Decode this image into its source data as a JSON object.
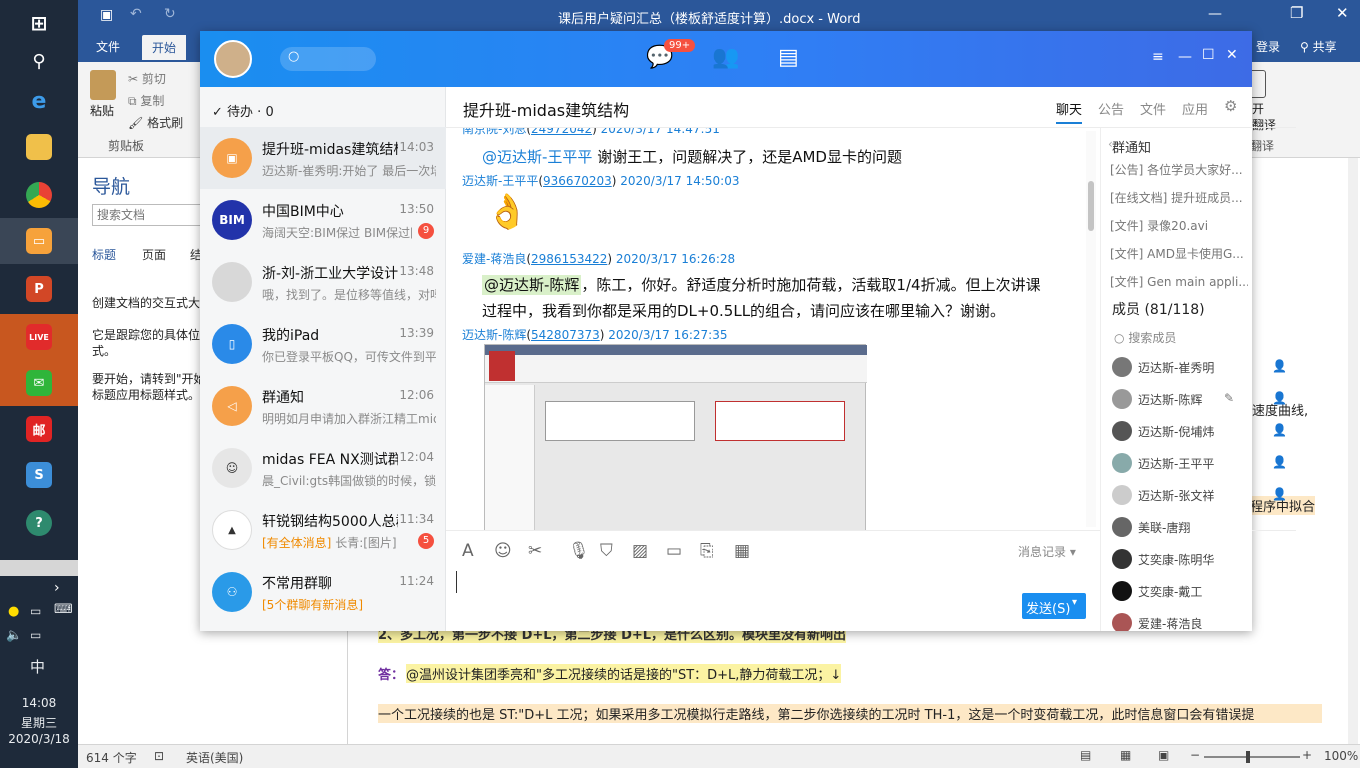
{
  "taskbar": {
    "items": [
      {
        "label": "start-icon"
      },
      {
        "label": "search-icon"
      },
      {
        "label": "edge-icon"
      },
      {
        "label": "explorer-icon"
      },
      {
        "label": "chrome-icon"
      },
      {
        "label": "app-icon"
      },
      {
        "label": "powerpoint-icon"
      },
      {
        "label": "live-icon"
      },
      {
        "label": "wechat-icon"
      },
      {
        "label": "mail-icon"
      },
      {
        "label": "s-icon"
      },
      {
        "label": "help-icon"
      }
    ],
    "ime": "中",
    "time": "14:08",
    "weekday": "星期三",
    "date": "2020/3/18"
  },
  "word": {
    "title": "课后用户疑问汇总（楼板舒适度计算）.docx - Word",
    "tabs": {
      "file": "文件",
      "home": "开始"
    },
    "login": "登录",
    "share": "共享",
    "clipboard": {
      "paste": "粘贴",
      "cut": "剪切",
      "copy": "复制",
      "format_painter": "格式刷",
      "group": "剪贴板"
    },
    "translate": {
      "open": "打开",
      "line2": "道翻译",
      "group": "道翻译"
    },
    "nav": {
      "title": "导航",
      "search_placeholder": "搜索文档",
      "tabs": [
        "标题",
        "页面",
        "结"
      ],
      "p1": "创建文档的交互式大",
      "p2a": "它是跟踪您的具体位",
      "p2b": "式。",
      "p3a": "要开始，请转到\"开始",
      "p3b": "标题应用标题样式。"
    },
    "doc": {
      "right1": "速度曲线,",
      "right2": "程序中拟合",
      "line_q2": "2、多工况，第一步不接 D+L，第二步接 D+L，是什么区别。模块里没有新响出",
      "answer_label": "答：",
      "answer_text": "@温州设计集团季亮和\"多工况接续的话是接的\"ST：D+L,静力荷载工况；↓",
      "line3": "一个工况接续的也是 ST:\"D+L 工况；如果采用多工况模拟行走路线，第二步你选接续的工况时 TH-1，这是一个时变荷载工况，此时信息窗口会有错误提"
    },
    "status": {
      "words": "614 个字",
      "lang": "英语(美国)",
      "zoom": "100%"
    }
  },
  "qq": {
    "badge": "99+",
    "todo": "待办 · 0",
    "conversations": [
      {
        "name": "提升班-midas建筑结构",
        "time": "14:03",
        "preview": "迈达斯-崔秀明:开始了 最后一次培训",
        "badge": ""
      },
      {
        "name": "中国BIM中心",
        "time": "13:50",
        "preview": "海阔天空:BIM保过 BIM保过[图片]",
        "badge": "9"
      },
      {
        "name": "浙-刘-浙工业大学设计院",
        "time": "13:48",
        "preview": "哦，找到了。是位移等值线，对吗",
        "badge": ""
      },
      {
        "name": "我的iPad",
        "time": "13:39",
        "preview": "你已登录平板QQ，可传文件到平板",
        "badge": ""
      },
      {
        "name": "群通知",
        "time": "12:06",
        "preview": "明明如月申请加入群浙江精工midas",
        "badge": ""
      },
      {
        "name": "midas FEA NX测试群",
        "time": "12:04",
        "preview": "晨_Civil:gts韩国做锁的时候，锁",
        "badge": ""
      },
      {
        "name": "轩锐钢结构5000人总群",
        "time": "11:34",
        "preview_tag": "[有全体消息]",
        "preview": "长青:[图片]",
        "badge": "5"
      },
      {
        "name": "不常用群聊",
        "time": "11:24",
        "preview_tag": "[5个群聊有新消息]",
        "preview": "",
        "badge": ""
      }
    ],
    "chat": {
      "title": "提升班-midas建筑结构",
      "tabs": [
        "聊天",
        "公告",
        "文件",
        "应用"
      ],
      "messages": [
        {
          "sender": "南京院-刘总",
          "qqid": "24972042",
          "time": "2020/3/17 14:47:51"
        },
        {
          "mention": "@迈达斯-王平平",
          "text": "谢谢王工，问题解决了，还是AMD显卡的问题"
        },
        {
          "sender": "迈达斯-王平平",
          "qqid": "936670203",
          "time": "2020/3/17 14:50:03"
        },
        {
          "emoji": "👌"
        },
        {
          "sender": "爱建-蒋浩良",
          "qqid": "2986153422",
          "time": "2020/3/17 16:26:28"
        },
        {
          "mention": "@迈达斯-陈辉",
          "text": "，陈工，你好。舒适度分析时施加荷载，活载取1/4折减。但上次讲课"
        },
        {
          "text": "过程中，我看到你都是采用的DL+0.5LL的组合，请问应该在哪里输入？谢谢。"
        },
        {
          "sender": "迈达斯-陈辉",
          "qqid": "542807373",
          "time": "2020/3/17 16:27:35"
        }
      ],
      "history": "消息记录",
      "send": "发送(S)"
    },
    "sidebar": {
      "notice_title": "群通知",
      "notices": [
        "[公告] 各位学员大家好...",
        "[在线文档] 提升班成员...",
        "[文件] 录像20.avi",
        "[文件] AMD显卡使用G...",
        "[文件] Gen main appli..."
      ],
      "members_title": "成员 (81/118)",
      "search_members": "搜索成员",
      "members": [
        "迈达斯-崔秀明",
        "迈达斯-陈辉",
        "迈达斯-倪埔炜",
        "迈达斯-王平平",
        "迈达斯-张文祥",
        "美联-唐翔",
        "艾奕康-陈明华",
        "艾奕康-戴工",
        "爱建-蒋浩良"
      ]
    }
  }
}
